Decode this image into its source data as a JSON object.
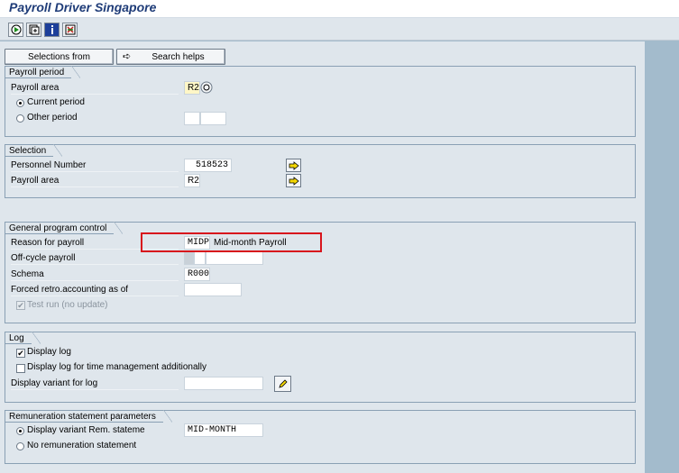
{
  "window": {
    "title": "Payroll Driver Singapore"
  },
  "toolbar": {
    "icons": [
      "execute-icon",
      "variant-icon",
      "info-icon",
      "selection-options-icon"
    ],
    "selections_from_label": "Selections from",
    "search_helps_label": "Search helps"
  },
  "payroll_period": {
    "heading": "Payroll period",
    "payroll_area_label": "Payroll area",
    "payroll_area_value": "R2",
    "current_period_label": "Current period",
    "other_period_label": "Other period",
    "selected": "current"
  },
  "selection": {
    "heading": "Selection",
    "personnel_number_label": "Personnel Number",
    "personnel_number_value": "518523",
    "payroll_area_label": "Payroll area",
    "payroll_area_value": "R2"
  },
  "general": {
    "heading": "General program control",
    "reason_label": "Reason for payroll",
    "reason_code": "MIDP",
    "reason_text": "Mid-month Payroll",
    "offcycle_label": "Off-cycle payroll",
    "schema_label": "Schema",
    "schema_value": "R000",
    "forced_retro_label": "Forced retro.accounting as of",
    "test_run_label": "Test run (no update)",
    "test_run_checked": true
  },
  "log": {
    "heading": "Log",
    "display_log_label": "Display log",
    "display_log_checked": true,
    "display_log_time_label": "Display log for time management additionally",
    "display_log_time_checked": false,
    "display_variant_label": "Display variant for log"
  },
  "remuneration": {
    "heading": "Remuneration statement parameters",
    "display_variant_label": "Display variant Rem. stateme",
    "display_variant_value": "MID-MONTH",
    "no_statement_label": "No remuneration statement",
    "selected": "display_variant"
  },
  "colors": {
    "title": "#1f3c78",
    "highlight": "#d8141c",
    "background": "#a3bbcc",
    "panel": "#dfe6ec"
  }
}
